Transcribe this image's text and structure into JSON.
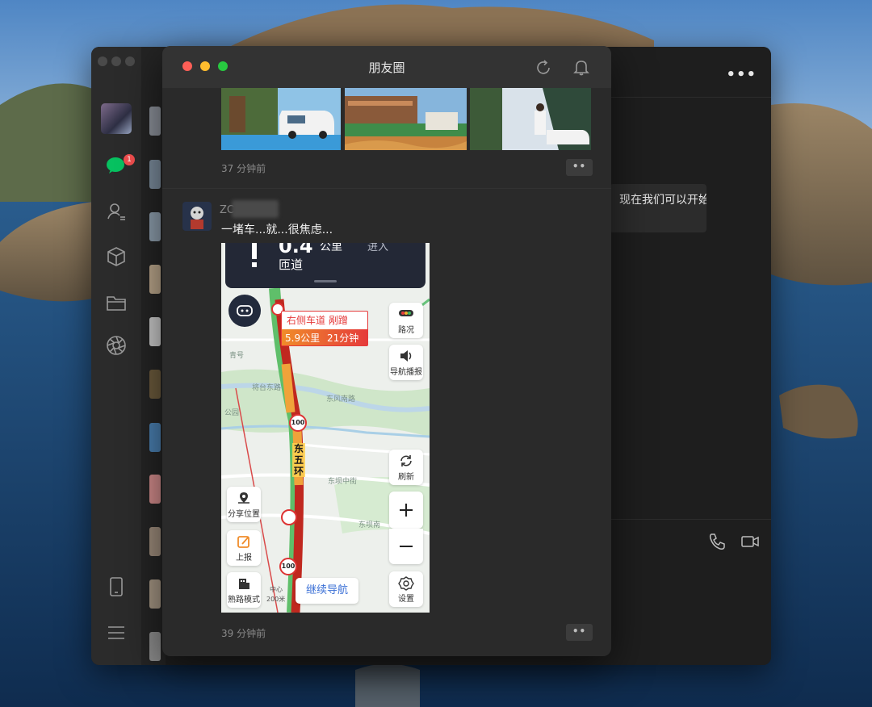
{
  "moments_window": {
    "title": "朋友圈",
    "post1_time": "37 分钟前",
    "post2_time": "39 分钟前",
    "more_label": "••",
    "post2": {
      "username_visible": "ZC",
      "text": "一堵车...就...很焦虑..."
    }
  },
  "chat": {
    "bubble_text": "现在我们可以开始",
    "more_menu": "•••"
  },
  "map": {
    "distance": "0.4",
    "distance_unit": "公里",
    "action": "进入",
    "road": "匝道",
    "lane_tip_top": "右侧车道  剐蹭",
    "lane_tip_distance": "5.9公里",
    "lane_tip_time": "21分钟",
    "road_vertical": "东五环",
    "btn_traffic": "路况",
    "btn_voice": "导航播报",
    "btn_refresh": "刷新",
    "btn_share": "分享位置",
    "btn_report": "上报",
    "btn_familiar": "熟路模式",
    "btn_settings": "设置",
    "continue_nav": "继续导航",
    "scale": "200米",
    "scale_center": "中心",
    "speed_limit": "100",
    "place_labels": [
      "将台东路",
      "东风南路",
      "东坝中街",
      "东坝南",
      "公园",
      "青号"
    ]
  },
  "colors": {
    "accent_green": "#07c160",
    "badge_red": "#f04e4e",
    "congestion_red": "#d7261e",
    "slow_orange": "#f2a23a"
  },
  "sidebar": {
    "chat_badge_count": "1"
  }
}
